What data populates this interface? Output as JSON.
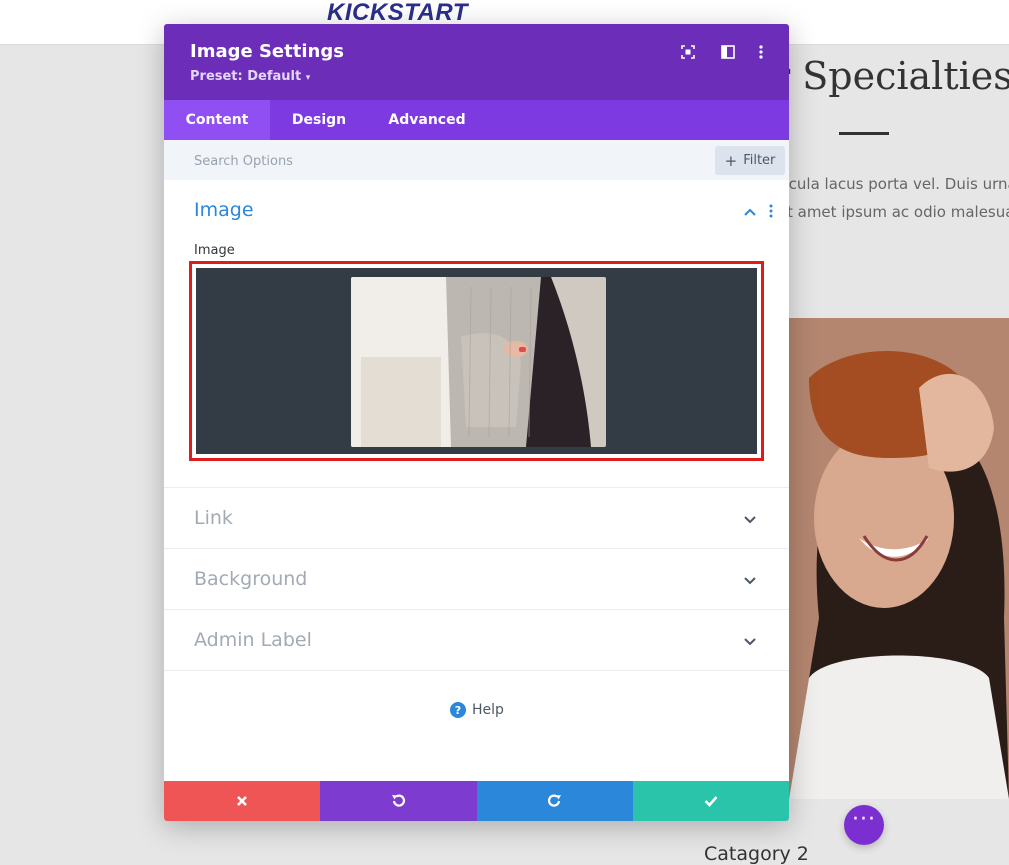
{
  "background_page": {
    "logo_text": "KICKSTART",
    "heading": "r Specialties",
    "paragraph_lines": [
      "hicula lacus porta vel. Duis urna",
      "sit amet ipsum ac odio malesuada"
    ],
    "category_title": "Catagory 2",
    "fab_icon": "more-dots-icon"
  },
  "modal": {
    "title": "Image Settings",
    "preset": "Preset: Default",
    "header_icons": [
      "fullscreen-icon",
      "split-view-icon",
      "more-vertical-icon"
    ],
    "tabs": [
      {
        "label": "Content",
        "active": true
      },
      {
        "label": "Design",
        "active": false
      },
      {
        "label": "Advanced",
        "active": false
      }
    ],
    "search": {
      "placeholder": "Search Options",
      "filter_label": "Filter"
    },
    "sections": {
      "image": {
        "title": "Image",
        "field_label": "Image"
      },
      "link": {
        "title": "Link"
      },
      "background": {
        "title": "Background"
      },
      "admin_label": {
        "title": "Admin Label"
      }
    },
    "help_label": "Help",
    "footer_buttons": [
      "discard-icon",
      "undo-icon",
      "redo-icon",
      "save-check-icon"
    ]
  },
  "colors": {
    "header": "#6c2eb9",
    "tabs": "#7c3ae0",
    "active_tab": "#8f4ff2",
    "accent_blue": "#2b87da",
    "discard": "#ef5555",
    "undo": "#7e3bd0",
    "redo": "#2b87da",
    "save": "#29c4a9",
    "highlight": "#e01b1b"
  }
}
